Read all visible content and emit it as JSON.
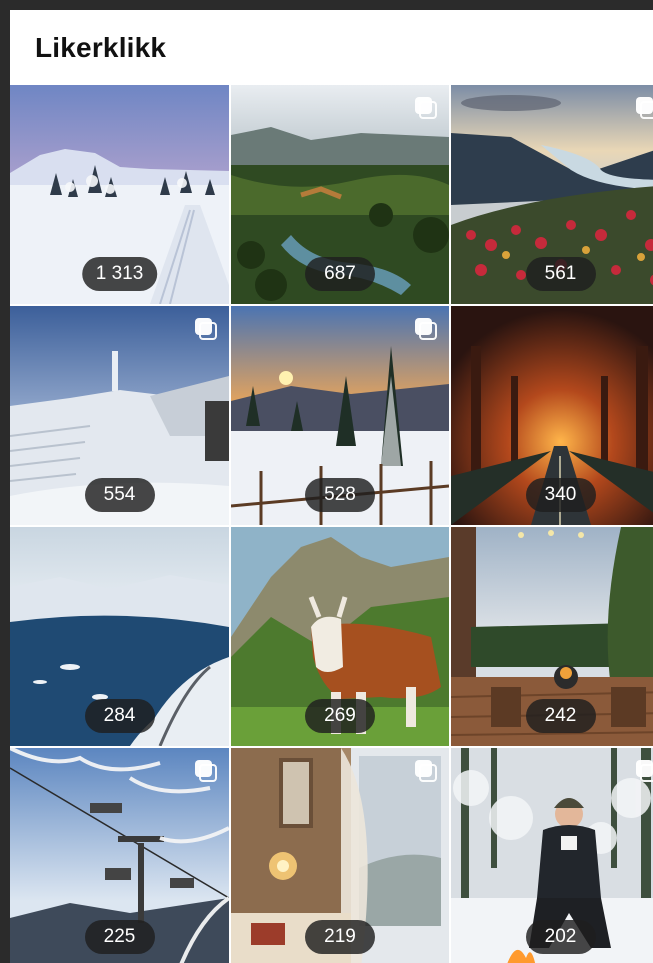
{
  "header": {
    "title": "Likerklikk"
  },
  "tiles": [
    {
      "likes": "1 313",
      "scene": "snowy-ski-trail",
      "carousel": false
    },
    {
      "likes": "687",
      "scene": "valley-river",
      "carousel": true
    },
    {
      "likes": "561",
      "scene": "fjord-flowers",
      "carousel": true
    },
    {
      "likes": "554",
      "scene": "snowy-mountain-stairs",
      "carousel": true
    },
    {
      "likes": "528",
      "scene": "winter-sunset-forest",
      "carousel": true
    },
    {
      "likes": "340",
      "scene": "autumn-tree-road",
      "carousel": false
    },
    {
      "likes": "284",
      "scene": "frozen-lake-road",
      "carousel": false
    },
    {
      "likes": "269",
      "scene": "cow-mountain",
      "carousel": false
    },
    {
      "likes": "242",
      "scene": "cabin-terrace-fire",
      "carousel": false
    },
    {
      "likes": "225",
      "scene": "ski-lift-frost",
      "carousel": true
    },
    {
      "likes": "219",
      "scene": "cozy-window-lamp",
      "carousel": true
    },
    {
      "likes": "202",
      "scene": "winter-camp-woman",
      "carousel": true
    }
  ]
}
